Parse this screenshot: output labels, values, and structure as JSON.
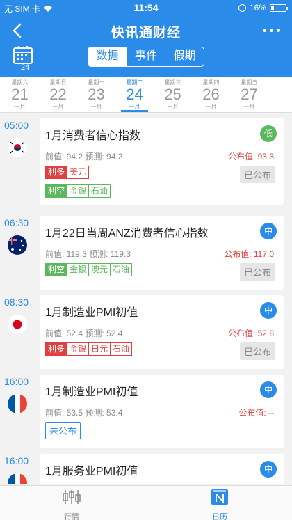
{
  "status_bar": {
    "carrier": "无 SIM 卡",
    "time": "11:54",
    "battery": "16%"
  },
  "header": {
    "title": "快讯通财经",
    "calendar_day": "24"
  },
  "segments": [
    {
      "label": "数据",
      "active": true
    },
    {
      "label": "事件",
      "active": false
    },
    {
      "label": "假期",
      "active": false
    }
  ],
  "days": [
    {
      "week": "星期六",
      "num": "21",
      "month": "一月",
      "active": false
    },
    {
      "week": "星期日",
      "num": "22",
      "month": "一月",
      "active": false
    },
    {
      "week": "星期一",
      "num": "23",
      "month": "一月",
      "active": false
    },
    {
      "week": "星期二",
      "num": "24",
      "month": "一月",
      "active": true
    },
    {
      "week": "星期三",
      "num": "25",
      "month": "一月",
      "active": false
    },
    {
      "week": "星期四",
      "num": "26",
      "month": "一月",
      "active": false
    },
    {
      "week": "星期五",
      "num": "27",
      "month": "一月",
      "active": false
    }
  ],
  "events": [
    {
      "time": "05:00",
      "flag": "kr",
      "title": "1月消费者信心指数",
      "importance": "低",
      "values": "前值: 94.2  预测: 94.2",
      "actual": "公布值: 93.3",
      "tags": [
        {
          "head": "利多",
          "items": [
            "美元"
          ],
          "kind": "good"
        },
        {
          "head": "利空",
          "items": [
            "金银",
            "石油"
          ],
          "kind": "bad"
        }
      ],
      "status": "已公布"
    },
    {
      "time": "06:30",
      "flag": "au",
      "title": "1月22日当周ANZ消费者信心指数",
      "importance": "中",
      "values": "前值: 119.3  预测: 119.3",
      "actual": "公布值: 117.0",
      "tags": [
        {
          "head": "利空",
          "items": [
            "金银",
            "澳元",
            "石油"
          ],
          "kind": "bad"
        }
      ],
      "status": "已公布"
    },
    {
      "time": "08:30",
      "flag": "jp",
      "title": "1月制造业PMI初值",
      "importance": "中",
      "values": "前值: 52.4  预测: 52.4",
      "actual": "公布值: 52.8",
      "tags": [
        {
          "head": "利多",
          "items": [
            "金银",
            "日元",
            "石油"
          ],
          "kind": "good"
        }
      ],
      "status": "已公布"
    },
    {
      "time": "16:00",
      "flag": "fr",
      "title": "1月制造业PMI初值",
      "importance": "中",
      "values": "前值: 53.5  预测: 53.4",
      "actual": "公布值: --",
      "tags": [],
      "status": "未公布"
    },
    {
      "time": "16:00",
      "flag": "fr",
      "title": "1月服务业PMI初值",
      "importance": "中",
      "values": "",
      "actual": "",
      "tags": [],
      "status": ""
    }
  ],
  "tabs": [
    {
      "label": "行情",
      "active": false
    },
    {
      "label": "日历",
      "active": true
    }
  ],
  "colors": {
    "brand": "#2b8be8",
    "positive": "#e04040",
    "negative": "#5cb85c"
  }
}
